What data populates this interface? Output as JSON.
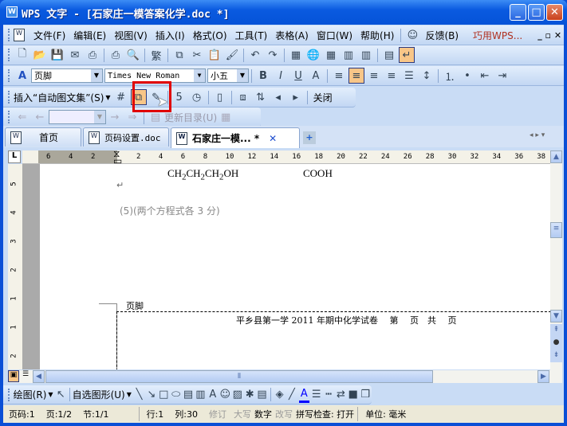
{
  "window": {
    "title": "WPS 文字 - [石家庄一模答案化学.doc *]",
    "logo": "W"
  },
  "menu": {
    "items": [
      "文件(F)",
      "编辑(E)",
      "视图(V)",
      "插入(I)",
      "格式(O)",
      "工具(T)",
      "表格(A)",
      "窗口(W)",
      "帮助(H)"
    ],
    "feedback": "反馈(B)",
    "tips": "巧用WPS..."
  },
  "toolbar_standard": {
    "icons": [
      "new-doc-icon",
      "open-folder-icon",
      "save-icon",
      "email-icon",
      "export-pdf-icon",
      "sep",
      "print-icon",
      "print-preview-icon",
      "sep",
      "traditional-chinese-icon",
      "sep",
      "copy-icon",
      "cut-icon",
      "paste-icon",
      "format-painter-icon",
      "sep",
      "undo-icon",
      "redo-icon",
      "sep",
      "insert-table-icon",
      "hyperlink-icon",
      "table-icon",
      "columns-icon",
      "chart-icon",
      "sep",
      "document-map-icon",
      "show-marks-icon"
    ]
  },
  "toolbar_format": {
    "style": "页脚",
    "font": "Times New Roman",
    "size": "小五",
    "icons": [
      "bold-icon",
      "italic-icon",
      "underline-icon",
      "font-color-icon",
      "sep",
      "align-left-icon",
      "align-center-icon",
      "align-right-icon",
      "justify-icon",
      "distributed-icon",
      "line-spacing-icon",
      "sep",
      "numbering-icon",
      "bullets-icon",
      "decrease-indent-icon",
      "increase-indent-icon"
    ]
  },
  "toolbar_header_footer": {
    "insert_autotext": "插入“自动图文集”(S)",
    "icons": [
      "insert-page-number-icon",
      "insert-page-count-icon",
      "format-page-number-icon",
      "sep",
      "insert-date-icon",
      "insert-time-icon",
      "sep",
      "page-setup-icon",
      "sep",
      "same-as-previous-icon",
      "switch-header-footer-icon",
      "show-previous-icon",
      "show-next-icon"
    ],
    "close": "关闭"
  },
  "toolbar_nav": {
    "update_toc": "更新目录(U)"
  },
  "tabs": [
    {
      "label": "首页"
    },
    {
      "label": "页码设置.doc"
    },
    {
      "label": "石家庄一模... *",
      "active": true
    }
  ],
  "ruler": {
    "left": [
      "6",
      "4",
      "2"
    ],
    "right": [
      "2",
      "4",
      "6",
      "8",
      "10",
      "12",
      "14",
      "16",
      "18",
      "20",
      "22",
      "24",
      "26",
      "28",
      "30",
      "32",
      "34",
      "36",
      "38"
    ]
  },
  "vruler": [
    "5",
    "4",
    "3",
    "2",
    "1",
    "1",
    "2"
  ],
  "document": {
    "formula1_parts": [
      "CH",
      "2",
      "CH",
      "2",
      "CH",
      "2",
      "OH"
    ],
    "formula2": "COOH",
    "note": "(5)(两个方程式各 3 分)",
    "footer_label": "页脚",
    "footer_text": "平乡县第一学 2011 年期中化学试卷　 第　 页　共　 页"
  },
  "draw_toolbar": {
    "draw": "绘图(R)",
    "autoshapes": "自选图形(U)",
    "icons": [
      "line-icon",
      "arrow-icon",
      "rectangle-icon",
      "ellipse-icon",
      "textbox-icon",
      "vertical-textbox-icon",
      "wordart-icon",
      "clipart-icon",
      "picture-icon",
      "diagram-icon",
      "insert-object-icon",
      "sep",
      "fill-color-icon",
      "line-color-icon",
      "font-color-icon",
      "line-style-icon",
      "dash-style-icon",
      "arrow-style-icon",
      "shadow-icon",
      "3d-icon"
    ]
  },
  "status": {
    "page_no": "页码:1",
    "page": "页:1/2",
    "section": "节:1/1",
    "line": "行:1",
    "col": "列:30",
    "track": "修订",
    "caps": "大写",
    "num": "数字",
    "ovr": "改写",
    "spell": "拼写检查: 打开",
    "unit": "单位: 毫米"
  },
  "colors": {
    "titlebar": "#0553d8",
    "highlight": "#e00000",
    "active_button": "#f8c688"
  }
}
